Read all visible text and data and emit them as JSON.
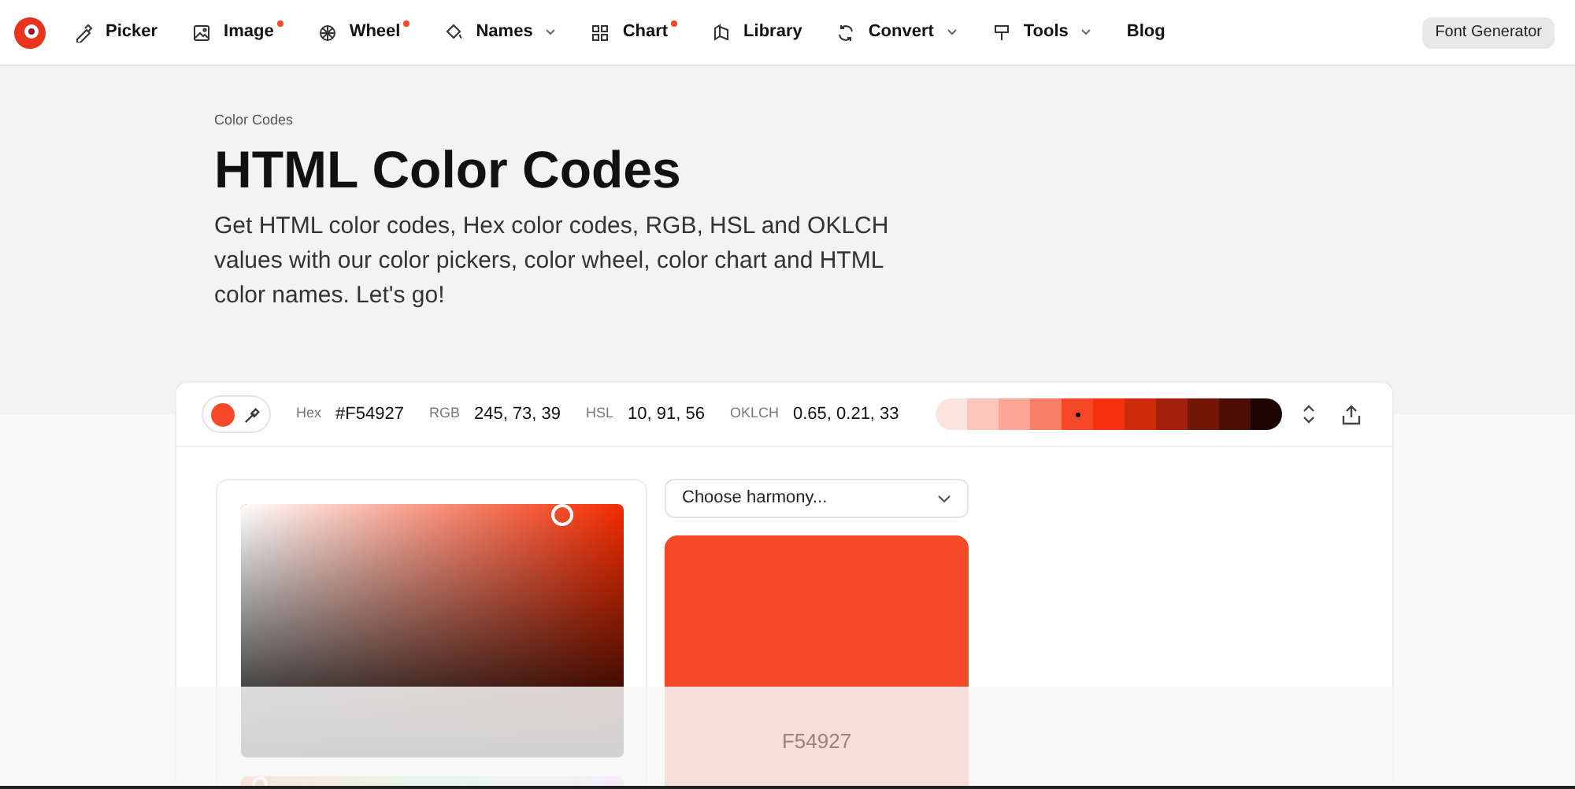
{
  "nav": {
    "items": [
      {
        "label": "Picker",
        "badge": false,
        "dropdown": false
      },
      {
        "label": "Image",
        "badge": true,
        "dropdown": false
      },
      {
        "label": "Wheel",
        "badge": true,
        "dropdown": false
      },
      {
        "label": "Names",
        "badge": false,
        "dropdown": true
      },
      {
        "label": "Chart",
        "badge": true,
        "dropdown": false
      },
      {
        "label": "Library",
        "badge": false,
        "dropdown": false
      },
      {
        "label": "Convert",
        "badge": false,
        "dropdown": true
      },
      {
        "label": "Tools",
        "badge": false,
        "dropdown": true
      },
      {
        "label": "Blog",
        "badge": false,
        "dropdown": false
      }
    ],
    "button": "Font Generator"
  },
  "hero": {
    "breadcrumb": "Color Codes",
    "title": "HTML Color Codes",
    "intro": "Get HTML color codes, Hex color codes, RGB, HSL and OKLCH values with our color pickers, color wheel, color chart and HTML color names. Let's go!"
  },
  "toolbar": {
    "values": [
      {
        "label": "Hex",
        "value": "#F54927"
      },
      {
        "label": "RGB",
        "value": "245, 73, 39"
      },
      {
        "label": "HSL",
        "value": "10, 91, 56"
      },
      {
        "label": "OKLCH",
        "value": "0.65, 0.21, 33"
      }
    ],
    "shades": [
      {
        "color": "#fde4df",
        "selected": false
      },
      {
        "color": "#fcc5b9",
        "selected": false
      },
      {
        "color": "#fba594",
        "selected": false
      },
      {
        "color": "#f97e66",
        "selected": false
      },
      {
        "color": "#f54927",
        "selected": true
      },
      {
        "color": "#f5310e",
        "selected": false
      },
      {
        "color": "#cc2a0b",
        "selected": false
      },
      {
        "color": "#a12009",
        "selected": false
      },
      {
        "color": "#751707",
        "selected": false
      },
      {
        "color": "#4a0e04",
        "selected": false
      },
      {
        "color": "#1c0502",
        "selected": false
      }
    ]
  },
  "picker": {
    "hue_slider": {
      "level": 0.03
    }
  },
  "harmony": {
    "placeholder": "Choose harmony...",
    "swatch_label": "F54927"
  }
}
